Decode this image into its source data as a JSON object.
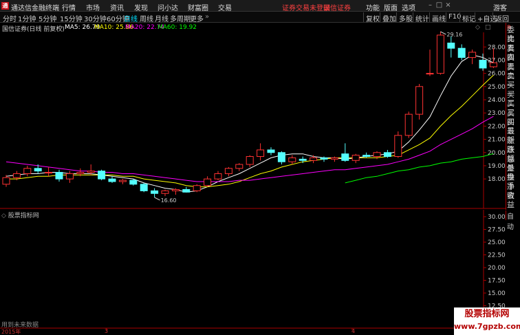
{
  "app": {
    "title": "通达信金融终端",
    "menus": [
      "行情",
      "市场",
      "资讯",
      "发现",
      "问小达",
      "财富圈",
      "交易"
    ],
    "notice_left": "证券交易未登录",
    "notice_right": "国信证券",
    "right_menus": [
      "功能",
      "版面",
      "选项"
    ],
    "guest": "游客"
  },
  "toolbar": {
    "periods": [
      "分时",
      "1分钟",
      "5分钟",
      "15分钟",
      "30分钟",
      "60分钟",
      "日线",
      "周线",
      "月线",
      "多周期",
      "更多"
    ],
    "active_period": "日线",
    "buttons": [
      "复权",
      "叠加",
      "多股",
      "统计",
      "画线",
      "F10",
      "标记",
      "+自选",
      "返回"
    ]
  },
  "chart_header": {
    "title": "国信证券(日线 前复权)",
    "ma5_label": "MA5: 26.79",
    "ma10_label": "MA10: 25.86",
    "ma20_label": "MA20: 22.74",
    "ma60_label": "MA60: 19.92",
    "ma5_color": "#ffffff",
    "ma10_color": "#ffff00",
    "ma20_color": "#ff00ff",
    "ma60_color": "#00ff00"
  },
  "right_panel": {
    "back": "R",
    "items": [
      "委比",
      "卖五",
      "卖四",
      "卖三",
      "卖二",
      "卖一",
      "买一",
      "买二",
      "买三",
      "买四",
      "买五",
      "最新",
      "涨跌",
      "涨幅",
      "总量",
      "外盘",
      "换手",
      "净资",
      "收益"
    ]
  },
  "indicator": {
    "title": "股票指标网",
    "no_data": "用到未来数据",
    "auto": "自动",
    "yticks": [
      30.0,
      27.5,
      25.0,
      22.5,
      20.0,
      17.5,
      15.0,
      12.5,
      10.0
    ],
    "ytick_labels": [
      "30.00",
      "27.50",
      "25.00",
      "22.50",
      "20.00",
      "17.50",
      "15.00",
      "12.50",
      "10.00"
    ]
  },
  "xaxis": {
    "labels": [
      "2015年",
      "3",
      "4"
    ]
  },
  "watermark": {
    "line1": "股票指标网",
    "line2": "www.7gpzb.com"
  },
  "chart_data": {
    "type": "candlestick",
    "title": "国信证券(日线 前复权)",
    "ylim": [
      16.8,
      30.0
    ],
    "yticks": [
      18.0,
      19.0,
      20.0,
      21.0,
      22.0,
      23.0,
      24.0,
      25.0,
      26.0,
      27.0,
      28.0
    ],
    "ytick_labels": [
      "18.00",
      "19.00",
      "20.00",
      "21.00",
      "22.00",
      "23.00",
      "24.00",
      "25.00",
      "26.00",
      "27.00",
      "28.00"
    ],
    "annotations": [
      {
        "label": "16.60",
        "type": "low",
        "value": 16.6
      },
      {
        "label": "29.16",
        "type": "high",
        "value": 29.16
      }
    ],
    "candles": [
      {
        "o": 17.6,
        "h": 18.3,
        "l": 17.4,
        "c": 18.1
      },
      {
        "o": 18.1,
        "h": 18.6,
        "l": 17.9,
        "c": 18.4
      },
      {
        "o": 18.4,
        "h": 19.0,
        "l": 18.2,
        "c": 18.8
      },
      {
        "o": 18.8,
        "h": 19.1,
        "l": 18.4,
        "c": 18.6
      },
      {
        "o": 18.5,
        "h": 18.9,
        "l": 18.2,
        "c": 18.5
      },
      {
        "o": 18.5,
        "h": 18.7,
        "l": 17.8,
        "c": 18.0
      },
      {
        "o": 18.0,
        "h": 18.6,
        "l": 17.7,
        "c": 18.4
      },
      {
        "o": 18.4,
        "h": 18.8,
        "l": 18.2,
        "c": 18.5
      },
      {
        "o": 18.5,
        "h": 19.1,
        "l": 18.3,
        "c": 18.6
      },
      {
        "o": 18.6,
        "h": 18.7,
        "l": 17.9,
        "c": 18.0
      },
      {
        "o": 18.0,
        "h": 18.2,
        "l": 17.7,
        "c": 17.8
      },
      {
        "o": 17.8,
        "h": 18.0,
        "l": 17.6,
        "c": 17.9
      },
      {
        "o": 17.9,
        "h": 18.0,
        "l": 17.5,
        "c": 17.6
      },
      {
        "o": 17.6,
        "h": 17.7,
        "l": 17.0,
        "c": 17.1
      },
      {
        "o": 17.1,
        "h": 17.3,
        "l": 16.6,
        "c": 16.9
      },
      {
        "o": 16.9,
        "h": 17.2,
        "l": 16.7,
        "c": 17.1
      },
      {
        "o": 17.1,
        "h": 17.3,
        "l": 16.8,
        "c": 17.2
      },
      {
        "o": 17.2,
        "h": 17.4,
        "l": 17.0,
        "c": 17.0
      },
      {
        "o": 17.1,
        "h": 17.6,
        "l": 17.0,
        "c": 17.5
      },
      {
        "o": 17.5,
        "h": 18.2,
        "l": 17.4,
        "c": 18.0
      },
      {
        "o": 18.0,
        "h": 18.6,
        "l": 17.9,
        "c": 18.4
      },
      {
        "o": 18.4,
        "h": 18.9,
        "l": 18.2,
        "c": 18.8
      },
      {
        "o": 18.8,
        "h": 19.2,
        "l": 18.6,
        "c": 19.1
      },
      {
        "o": 19.1,
        "h": 19.8,
        "l": 18.9,
        "c": 19.7
      },
      {
        "o": 19.7,
        "h": 20.7,
        "l": 19.4,
        "c": 20.2
      },
      {
        "o": 20.2,
        "h": 20.4,
        "l": 19.8,
        "c": 20.0
      },
      {
        "o": 20.0,
        "h": 20.1,
        "l": 19.1,
        "c": 19.3
      },
      {
        "o": 19.3,
        "h": 19.8,
        "l": 19.1,
        "c": 19.6
      },
      {
        "o": 19.5,
        "h": 19.7,
        "l": 19.2,
        "c": 19.4
      },
      {
        "o": 19.4,
        "h": 19.8,
        "l": 19.2,
        "c": 19.6
      },
      {
        "o": 19.6,
        "h": 19.7,
        "l": 19.3,
        "c": 19.5
      },
      {
        "o": 19.5,
        "h": 19.7,
        "l": 19.3,
        "c": 19.6
      },
      {
        "o": 19.9,
        "h": 20.7,
        "l": 19.3,
        "c": 19.4
      },
      {
        "o": 19.4,
        "h": 19.9,
        "l": 19.2,
        "c": 19.8
      },
      {
        "o": 19.8,
        "h": 20.0,
        "l": 19.6,
        "c": 19.7
      },
      {
        "o": 19.7,
        "h": 20.1,
        "l": 19.5,
        "c": 20.0
      },
      {
        "o": 20.0,
        "h": 20.2,
        "l": 19.6,
        "c": 19.7
      },
      {
        "o": 19.7,
        "h": 21.6,
        "l": 19.6,
        "c": 21.3
      },
      {
        "o": 21.3,
        "h": 23.1,
        "l": 21.1,
        "c": 22.9
      },
      {
        "o": 22.9,
        "h": 25.2,
        "l": 22.5,
        "c": 25.0
      },
      {
        "o": 26.0,
        "h": 27.8,
        "l": 25.8,
        "c": 26.0
      },
      {
        "o": 26.0,
        "h": 29.16,
        "l": 25.9,
        "c": 28.9
      },
      {
        "o": 28.3,
        "h": 28.8,
        "l": 27.2,
        "c": 27.9
      },
      {
        "o": 27.9,
        "h": 28.2,
        "l": 27.0,
        "c": 27.2
      },
      {
        "o": 27.2,
        "h": 27.8,
        "l": 26.7,
        "c": 27.6
      },
      {
        "o": 27.0,
        "h": 27.5,
        "l": 26.2,
        "c": 26.4
      },
      {
        "o": 26.5,
        "h": 27.9,
        "l": 26.4,
        "c": 26.8
      }
    ],
    "series": [
      {
        "name": "MA5",
        "color": "#ffffff",
        "start": 0,
        "values": [
          18.2,
          18.3,
          18.4,
          18.4,
          18.5,
          18.5,
          18.4,
          18.4,
          18.4,
          18.3,
          18.2,
          18.1,
          18.0,
          17.7,
          17.5,
          17.3,
          17.2,
          17.0,
          17.1,
          17.4,
          17.8,
          18.1,
          18.4,
          18.8,
          19.2,
          19.6,
          19.8,
          19.9,
          19.9,
          19.7,
          19.6,
          19.6,
          19.5,
          19.6,
          19.7,
          19.8,
          19.9,
          20.1,
          20.8,
          21.7,
          22.7,
          24.3,
          25.8,
          26.9,
          27.4,
          27.2,
          26.8
        ]
      },
      {
        "name": "MA10",
        "color": "#ffff00",
        "start": 0,
        "values": [
          18.0,
          18.0,
          18.1,
          18.2,
          18.2,
          18.3,
          18.3,
          18.3,
          18.3,
          18.3,
          18.3,
          18.2,
          18.2,
          18.0,
          17.9,
          17.8,
          17.7,
          17.5,
          17.4,
          17.4,
          17.5,
          17.6,
          17.8,
          18.1,
          18.4,
          18.6,
          18.9,
          19.1,
          19.3,
          19.4,
          19.5,
          19.6,
          19.6,
          19.6,
          19.6,
          19.6,
          19.7,
          19.8,
          20.2,
          20.6,
          21.1,
          22.0,
          22.8,
          23.5,
          24.3,
          25.1,
          25.86
        ]
      },
      {
        "name": "MA20",
        "color": "#ff00ff",
        "start": 0,
        "values": [
          19.3,
          19.2,
          19.1,
          19.0,
          18.9,
          18.8,
          18.7,
          18.6,
          18.6,
          18.5,
          18.5,
          18.4,
          18.4,
          18.3,
          18.2,
          18.1,
          18.0,
          17.9,
          17.8,
          17.8,
          17.8,
          17.8,
          17.9,
          17.9,
          18.0,
          18.1,
          18.2,
          18.3,
          18.4,
          18.5,
          18.6,
          18.7,
          18.7,
          18.8,
          18.9,
          19.0,
          19.1,
          19.3,
          19.5,
          19.8,
          20.1,
          20.6,
          21.0,
          21.4,
          21.8,
          22.3,
          22.74
        ]
      },
      {
        "name": "MA60",
        "color": "#00ff00",
        "start": 32,
        "values": [
          17.7,
          17.9,
          18.1,
          18.2,
          18.4,
          18.6,
          18.7,
          18.9,
          19.0,
          19.2,
          19.3,
          19.5,
          19.6,
          19.7,
          19.92
        ]
      }
    ]
  }
}
